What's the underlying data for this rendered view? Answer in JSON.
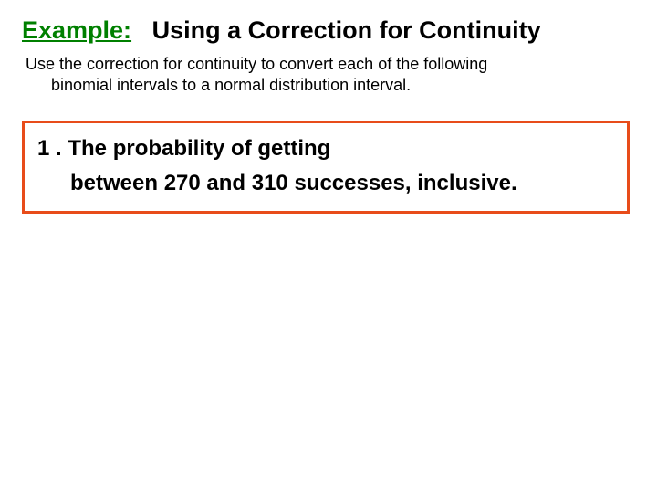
{
  "title": {
    "label": "Example:",
    "rest": "Using a Correction for Continuity"
  },
  "instruction": {
    "line1": "Use the correction for continuity to convert each of the following",
    "line2": "binomial intervals to a normal distribution interval."
  },
  "problem": {
    "line1": "1 . The probability of getting",
    "line2": "between 270 and 310 successes, inclusive."
  }
}
